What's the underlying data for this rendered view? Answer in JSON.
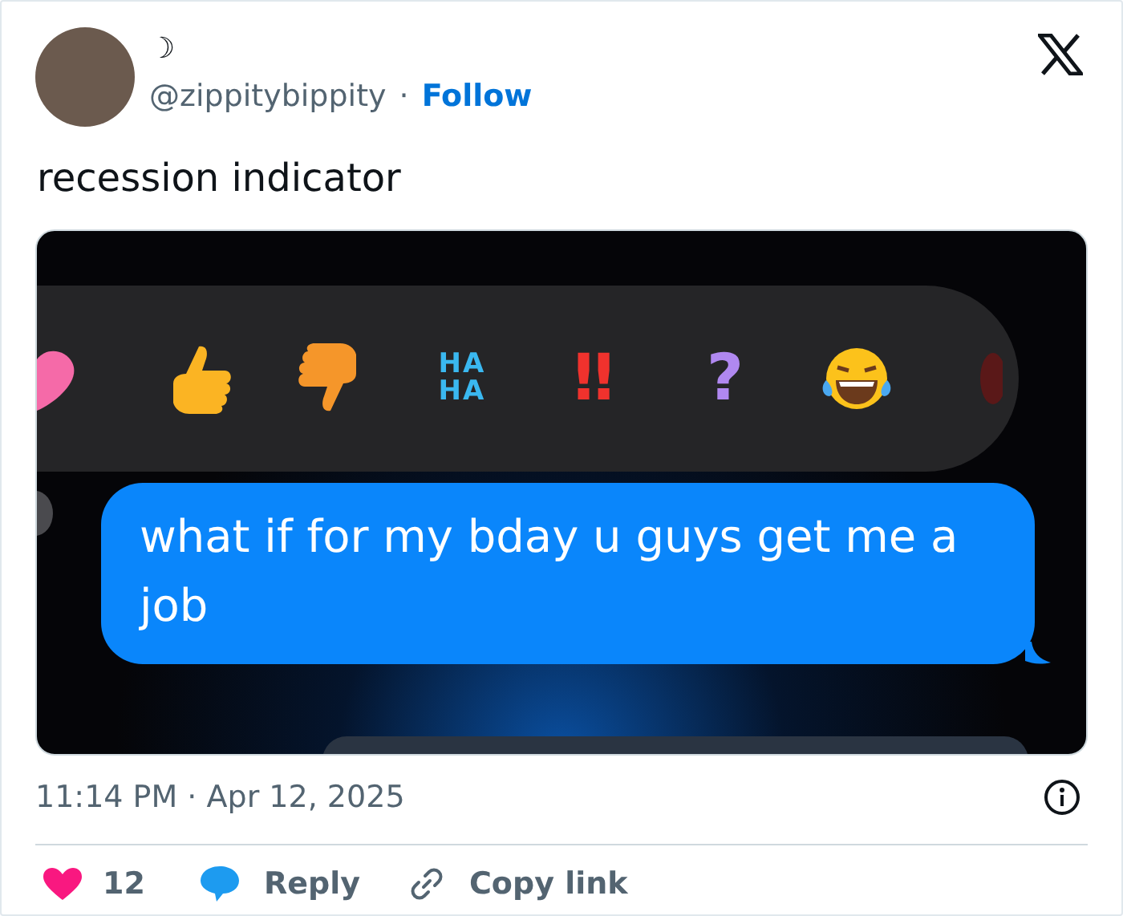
{
  "author": {
    "display_name": "☽",
    "handle": "@zippitybippity",
    "separator": "·",
    "follow": "Follow"
  },
  "text": "recession indicator",
  "media": {
    "reactions": [
      {
        "kind": "heart"
      },
      {
        "kind": "thumbs-up"
      },
      {
        "kind": "thumbs-down"
      },
      {
        "kind": "text",
        "text": "HA HA",
        "color": "#3ab8f0"
      },
      {
        "kind": "text",
        "text": "‼",
        "color": "#f0322d"
      },
      {
        "kind": "text",
        "text": "?",
        "color": "#b088f0"
      },
      {
        "kind": "laughing"
      },
      {
        "kind": "partial"
      }
    ],
    "message": "what if for my bday u guys get me a job"
  },
  "timestamp": "11:14 PM · Apr 12, 2025",
  "actions": {
    "likes": "12",
    "reply": "Reply",
    "copy_link": "Copy link"
  }
}
